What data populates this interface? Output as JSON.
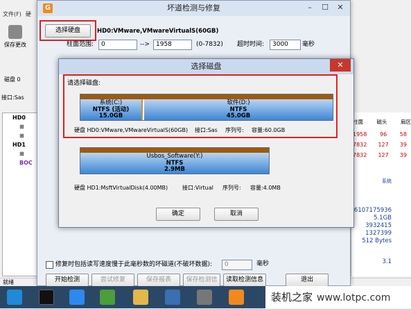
{
  "main_dialog": {
    "title": "坏道检测与修复",
    "select_disk_button": "选择硬盘",
    "disk_name": "HD0:VMware,VMwareVirtualS(60GB)",
    "range_label": "柱面范围:",
    "range_start": "0",
    "range_arrow": "-->",
    "range_end": "1958",
    "range_total": "(0-7832)",
    "timeout_label": "超时时间:",
    "timeout_value": "3000",
    "timeout_unit": "毫秒",
    "repair_slow_label": "修复时包括读写速度慢于此毫秒数的坏磁道(不破坏数据):",
    "repair_slow_value": "0",
    "repair_slow_unit": "毫秒",
    "buttons": {
      "start": "开始检测",
      "try_repair": "尝试修复",
      "save_report": "保存报表",
      "save_info": "保存检测信息",
      "read_info": "读取检测信息",
      "exit": "退出"
    }
  },
  "select_dialog": {
    "title": "选择磁盘",
    "prompt": "请选择磁盘:",
    "disks": [
      {
        "partitions": [
          {
            "name": "系统(C:)",
            "fs": "NTFS (活动)",
            "size": "15.0GB"
          },
          {
            "name": "软件(D:)",
            "fs": "NTFS",
            "size": "45.0GB"
          }
        ],
        "info": {
          "disk": "硬盘 HD0:VMware,VMwareVirtualS(60GB)",
          "port": "接口:Sas",
          "serial": "序列号:",
          "capacity": "容量:60.0GB"
        }
      },
      {
        "partitions": [
          {
            "name": "Usbos_Software(Y:)",
            "fs": "NTFS",
            "size": "2.9MB"
          }
        ],
        "info": {
          "disk": "硬盘 HD1:MsftVirtualDisk(4.00MB)",
          "port": "接口:Virtual",
          "serial": "序列号:",
          "capacity": "容量:4.0MB"
        }
      }
    ],
    "ok_button": "确定",
    "cancel_button": "取消"
  },
  "background": {
    "menu": [
      "文件(F)",
      "硬"
    ],
    "save_label": "保存更改",
    "back_label": "磁盘 0",
    "iface_label": "接口:Sas",
    "tree": [
      "HD0",
      "HD1",
      "BOC"
    ],
    "right_header": [
      "柱面",
      "磁头",
      "扇区"
    ],
    "right_rows": [
      [
        "1958",
        "96",
        "58"
      ],
      [
        "7832",
        "127",
        "39"
      ],
      [
        "7832",
        "127",
        "39"
      ]
    ],
    "right_label": "系统",
    "right_values": [
      "6107175936",
      "5.1GB",
      "3932415",
      "1327399",
      "512 Bytes",
      "3.1"
    ],
    "status": "就绪"
  },
  "branding": {
    "text": "装机之家",
    "url": "www.lotpc.com"
  }
}
